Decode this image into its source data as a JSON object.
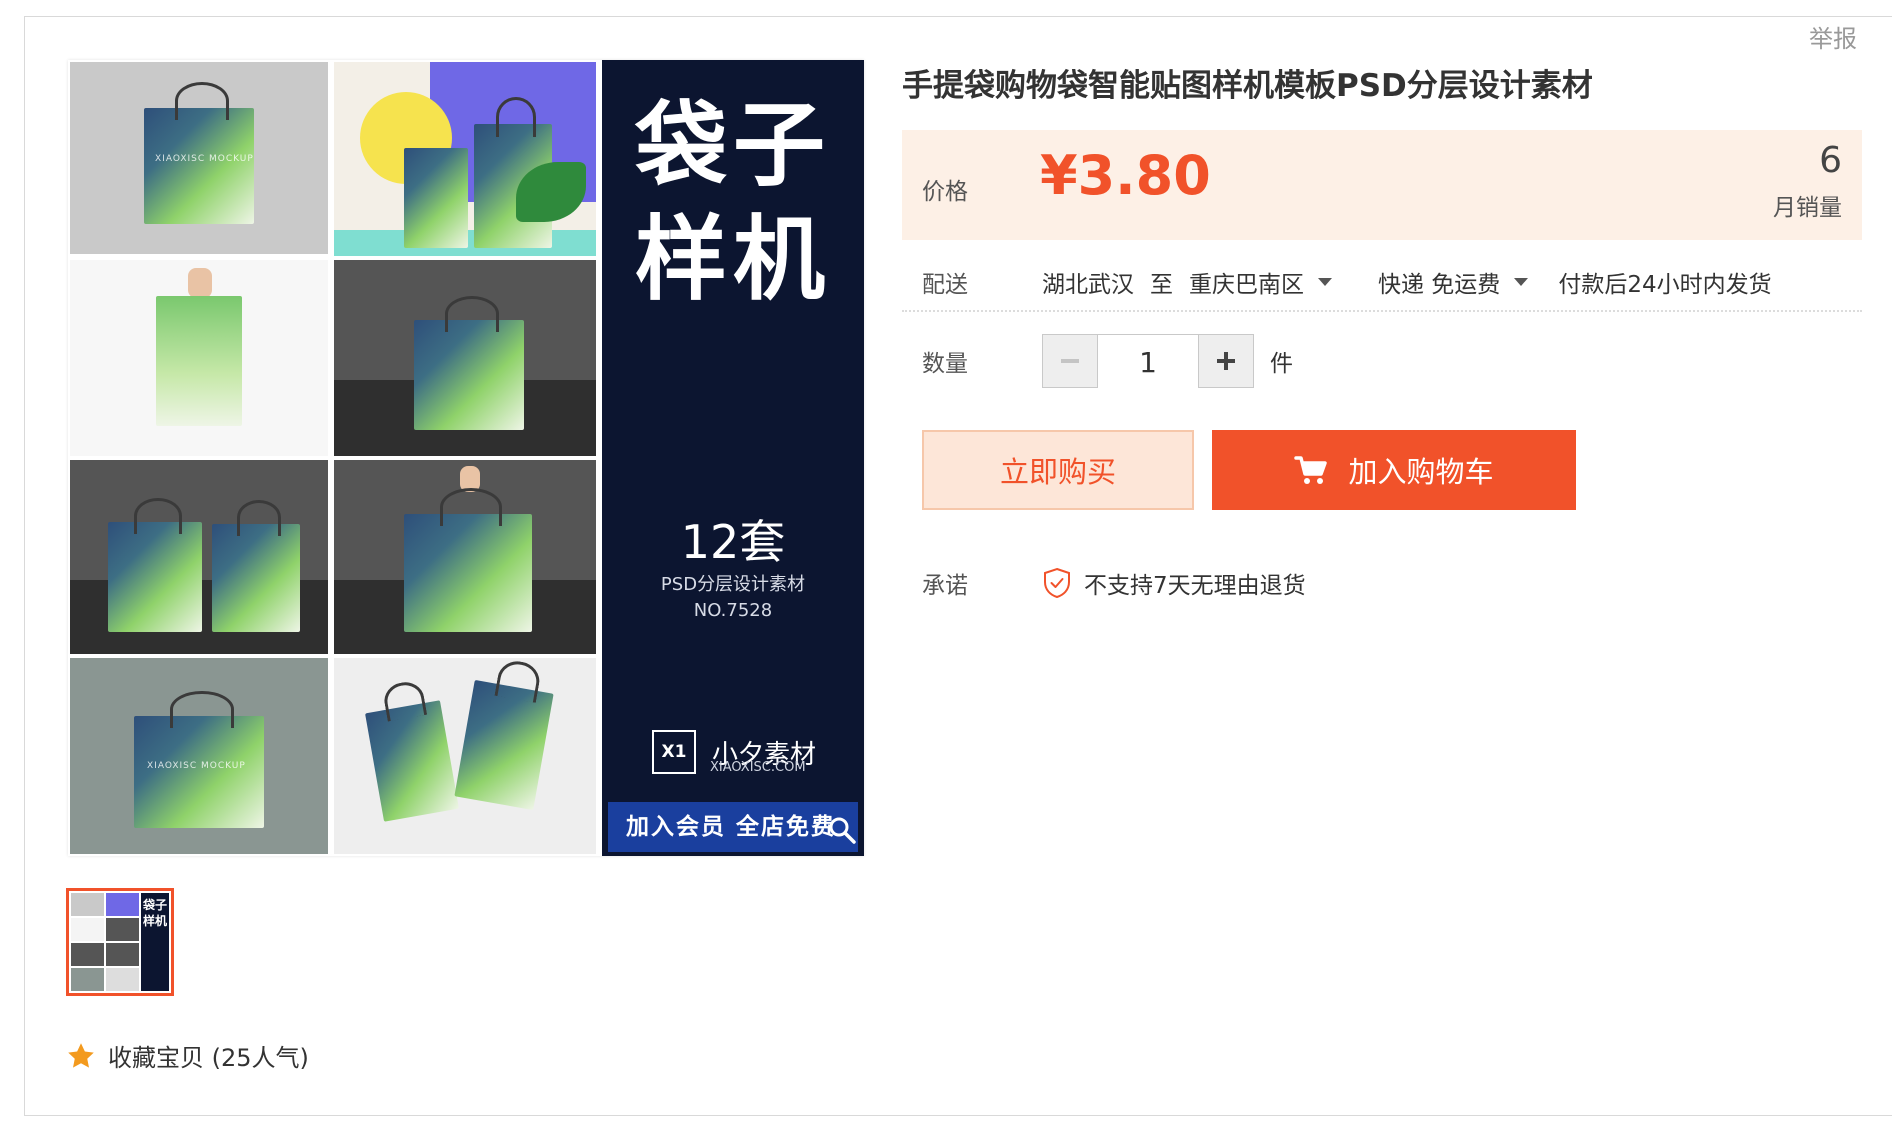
{
  "header": {
    "report_label": "举报"
  },
  "product": {
    "title": "手提袋购物袋智能贴图样机模板PSD分层设计素材",
    "price_label": "价格",
    "price": "¥3.80",
    "monthly_sales": "6",
    "monthly_sales_label": "月销量"
  },
  "delivery": {
    "label": "配送",
    "from": "湖北武汉",
    "to_word": "至",
    "destination": "重庆巴南区",
    "shipping": "快递 免运费",
    "dispatch": "付款后24小时内发货"
  },
  "quantity": {
    "label": "数量",
    "value": "1",
    "unit": "件"
  },
  "actions": {
    "buy_now": "立即购买",
    "add_to_cart": "加入购物车"
  },
  "promise": {
    "label": "承诺",
    "text": "不支持7天无理由退货"
  },
  "banner": {
    "title_line1": "袋子",
    "title_line2": "样机",
    "sets": "12套",
    "subtitle": "PSD分层设计素材",
    "number": "NO.7528",
    "brand_mark": "X1",
    "brand_name": "小夕素材",
    "brand_url": "XIAOXISC.COM",
    "member_cta": "加入会员 全店免费",
    "bag_print": "XIAOXISC MOCKUP"
  },
  "thumb_banner": {
    "line1": "袋子",
    "line2": "样机"
  },
  "favorite": {
    "label": "收藏宝贝 (25人气)"
  },
  "colors": {
    "accent": "#f1522a",
    "price_bg": "#fdf0e6",
    "banner_bg": "#0c1530"
  },
  "icons": [
    "minus-icon",
    "plus-icon",
    "cart-icon",
    "shield-check-icon",
    "star-icon",
    "zoom-icon"
  ]
}
